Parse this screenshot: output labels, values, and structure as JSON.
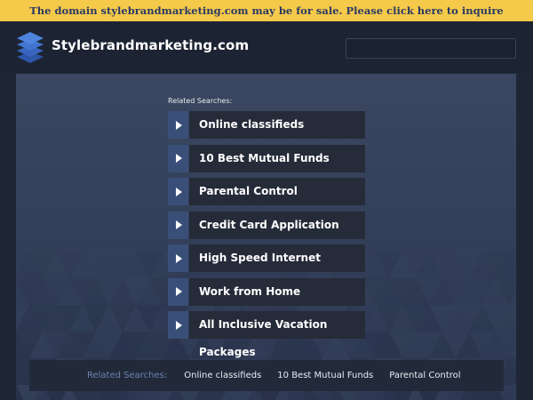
{
  "banner": {
    "text": "The domain stylebrandmarketing.com may be for sale. Please click here to inquire"
  },
  "header": {
    "site_name": "Stylebrandmarketing.com",
    "search_value": ""
  },
  "related": {
    "title": "Related Searches:",
    "items": [
      {
        "label": "Online classifieds"
      },
      {
        "label": "10 Best Mutual Funds"
      },
      {
        "label": "Parental Control"
      },
      {
        "label": "Credit Card Application"
      },
      {
        "label": "High Speed Internet"
      },
      {
        "label": "Work from Home"
      },
      {
        "label": "All Inclusive Vacation Packages"
      }
    ]
  },
  "footer": {
    "label": "Related Searches:",
    "links": [
      "Online classifieds",
      "10 Best Mutual Funds",
      "Parental Control"
    ]
  },
  "colors": {
    "banner_bg": "#f5c94a",
    "banner_text": "#2a3a63",
    "page_bg": "#1e2636",
    "panel_bg": "#3b4760",
    "arrow_box": "#3a4f78",
    "item_bg": "#252b38",
    "footer_label": "#6b82ad"
  },
  "icons": {
    "logo": "stacked-layers-icon",
    "item_arrow": "play-arrow-icon"
  }
}
